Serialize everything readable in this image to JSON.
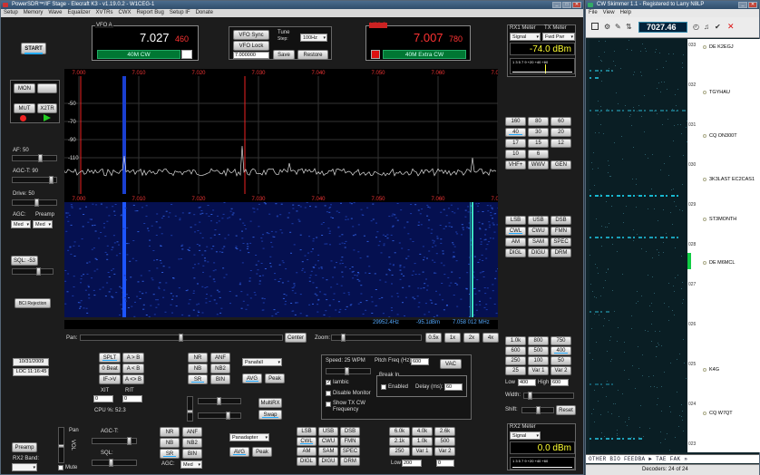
{
  "main": {
    "title": "PowerSDR™/IF Stage - Elecraft K3 - v1.19.0.2 - W1CEG-1",
    "menu": [
      "Setup",
      "Memory",
      "Wave",
      "Equalizer",
      "XVTRs",
      "CWX",
      "Report Bug",
      "Setup IF",
      "Donate"
    ],
    "start": "START",
    "vfoA": {
      "label": "VFO A",
      "freq": "7.027",
      "sub": "460",
      "band": "40M CW"
    },
    "vfoB": {
      "label": "VFO B",
      "freq": "7.007",
      "sub": "780",
      "band": "40M Extra CW"
    },
    "vfoSync": "VFO Sync",
    "vfoLock": "VFO Lock",
    "tune": "Tune",
    "step": "Step:",
    "stepVal": "100Hz",
    "vfoFreqBox": "7.000000",
    "save": "Save",
    "restore": "Restore",
    "rx1meter": "RX1 Meter",
    "txmeter": "TX Meter",
    "rx1sel": "Signal",
    "txsel": "Fwd Pwr",
    "rx1val": "-74.0 dBm",
    "meterScale": "1 3 5 7 9 +20 +40 +60",
    "freqTicks": [
      "7.000",
      "7.010",
      "7.020",
      "7.030",
      "7.040",
      "7.050",
      "7.060",
      "7.070"
    ],
    "dbTicks": [
      "-50",
      "-70",
      "-90",
      "-110"
    ],
    "readout": {
      "hz": "29952.4Hz",
      "dbm": "-95.1dBm",
      "mhz": "7.058 012 MHz"
    },
    "pan": "Pan:",
    "center": "Center",
    "zoom": "Zoom:",
    "zoomBtns": [
      "0.5x",
      "1x",
      "2x",
      "4x"
    ],
    "left": {
      "mon": "MON",
      "mut": "MUT",
      "x2tr": "X2TR",
      "af": "AF: 50",
      "agct": "AGC-T: 90",
      "drive": "Drive: 50",
      "agc": "AGC:",
      "preamp": "Preamp",
      "med": "Med",
      "sql": "SQL: -53",
      "bci": "BCI Rejection",
      "date": "10/31/2009",
      "loc": "LOC 11:16:45"
    },
    "bands": [
      "160",
      "80",
      "60",
      "40",
      "30",
      "20",
      "17",
      "15",
      "12",
      "10",
      "6",
      "",
      "VHF+",
      "WWV",
      "GEN"
    ],
    "modes": [
      "LSB",
      "USB",
      "DSB",
      "CWL",
      "CWU",
      "FMN",
      "AM",
      "SAM",
      "SPEC",
      "DIGL",
      "DIGU",
      "DRM"
    ],
    "filters": [
      "1.0k",
      "800",
      "750",
      "600",
      "500",
      "400",
      "250",
      "100",
      "50",
      "25",
      "Var 1",
      "Var 2"
    ],
    "low": "Low",
    "high": "High",
    "lowVal": "400",
    "highVal": "600",
    "width": "Width:",
    "shift": "Shift:",
    "reset": "Reset",
    "split": "SPLT",
    "ab": "A > B",
    "zbeat": "0 Beat",
    "ba": "A < B",
    "ifv": "IF->V",
    "aswap": "A <> B",
    "xit": "XIT",
    "rit": "RIT",
    "xitv": "0",
    "ritv": "0",
    "cpu": "CPU %: 52.3",
    "dsp": [
      "NR",
      "ANF",
      "NB",
      "NB2",
      "SR",
      "BIN"
    ],
    "display": "Panafall",
    "avg": "AVG",
    "peak": "Peak",
    "mutefx": "MultiRX",
    "swap": "Swap",
    "cw": {
      "speed": "Speed: 25 WPM",
      "pitch": "Pitch Freq (Hz):",
      "pitchVal": "600",
      "vac": "VAC",
      "iambic": "Iambic",
      "disableMon": "Disable Monitor",
      "showTx": "Show TX CW Frequency",
      "breakin": "Break In",
      "enabled": "Enabled",
      "delay": "Delay (ms):",
      "delayVal": "60"
    },
    "rx2": {
      "agct": "AGC-T:",
      "sql": "SQL:",
      "agc": "AGC:",
      "med": "Med",
      "preamp": "Preamp",
      "band": "RX2 Band:",
      "pan": "Pan",
      "vol": "VOL",
      "mute": "Mute",
      "display": "Panadapter",
      "meter": "RX2 Meter",
      "sig": "Signal",
      "val": "0.0 dBm",
      "filters": [
        "6.0k",
        "4.0k",
        "2.6k",
        "2.1k",
        "1.0k",
        "500",
        "250",
        "Var 1",
        "Var 2"
      ],
      "low": "Low",
      "lowVal": "200",
      "highVal": "0"
    }
  },
  "skimmer": {
    "title": "CW Skimmer 1.1 - Registered to Larry N8LP",
    "menu": [
      "File",
      "View",
      "Help"
    ],
    "freq": "7027.46",
    "scale": [
      "033",
      "032",
      "031",
      "030",
      "029",
      "028",
      "027",
      "026",
      "025",
      "024",
      "023"
    ],
    "calls": [
      "DE K2EGJ",
      "TGYHAU",
      "CQ ON300T",
      "3K3LAST EC2CAS1",
      "ST3MONTH",
      "DE M6MCL",
      "K4G",
      "CQ W7QT"
    ],
    "decoder": "OTHER BIO FEEDBA  ► TAE FAK  »",
    "status": "Decoders: 24 of 24"
  },
  "colors": {
    "bg": "#1c1c1c",
    "accent": "#2af",
    "vfoText": "#ffffff",
    "vfoSub": "#ff3333",
    "bandGreen": "#00aa33",
    "meterText": "#ffff33"
  }
}
